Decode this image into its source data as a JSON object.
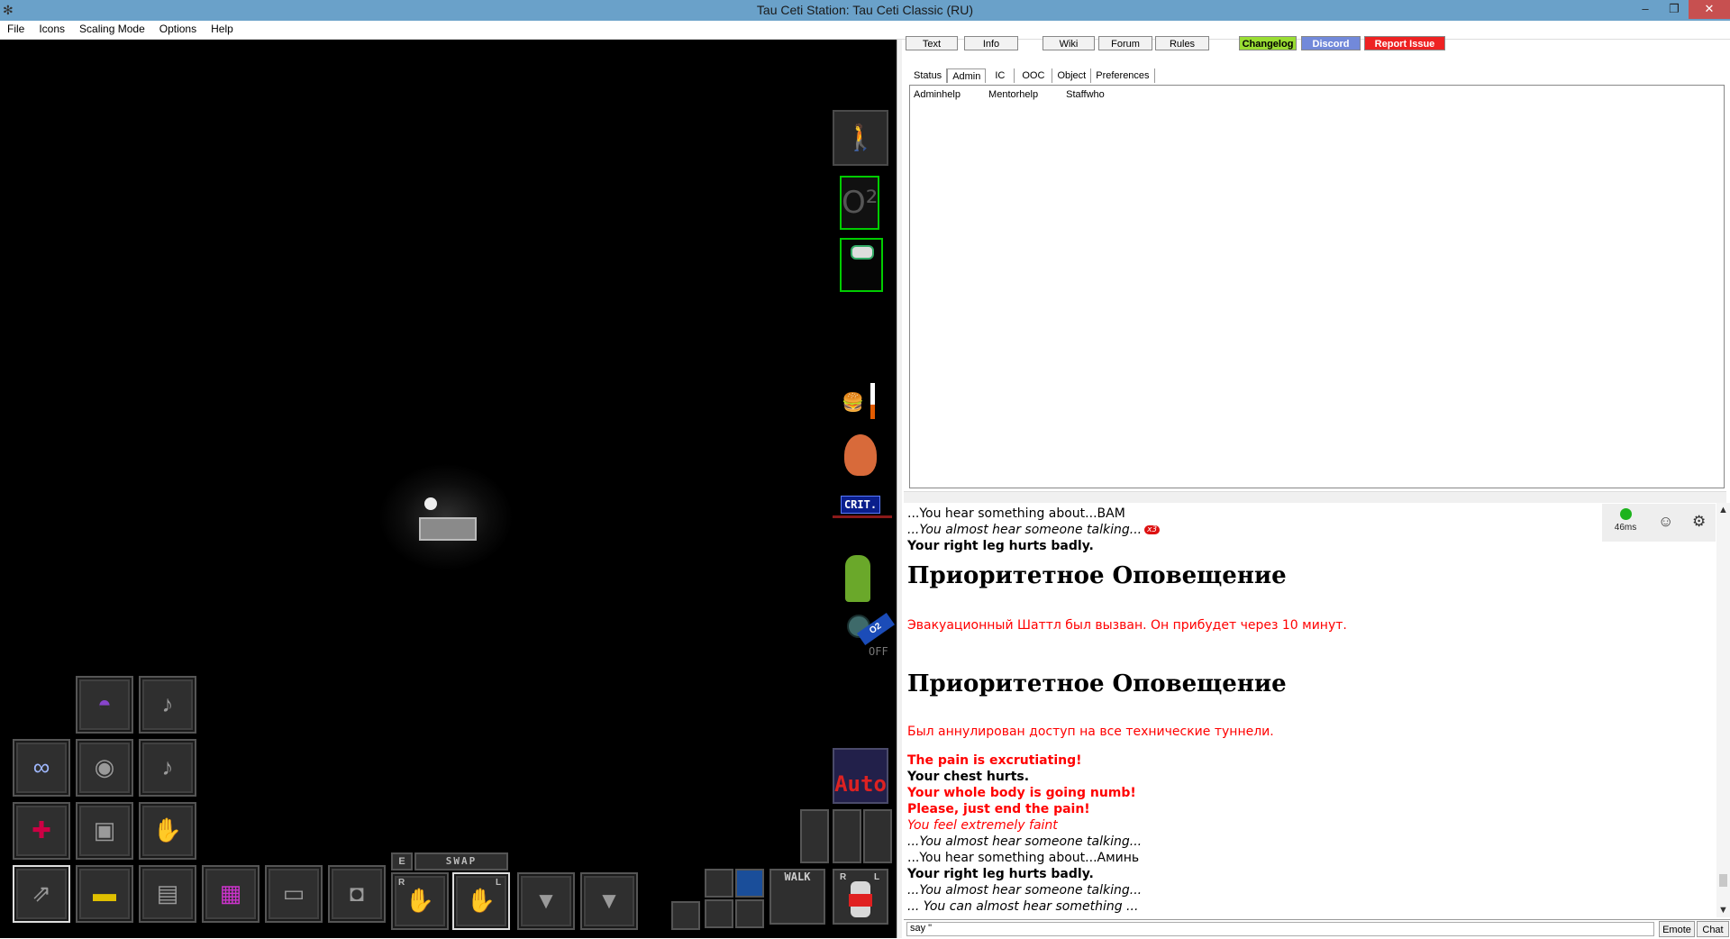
{
  "window": {
    "title": "Tau Ceti Station: Tau Ceti Classic (RU)",
    "minimize": "–",
    "restore": "❐",
    "close": "✕"
  },
  "menu": [
    "File",
    "Icons",
    "Scaling Mode",
    "Options",
    "Help"
  ],
  "top_buttons": {
    "text": "Text",
    "info": "Info",
    "wiki": "Wiki",
    "forum": "Forum",
    "rules": "Rules",
    "changelog": "Changelog",
    "discord": "Discord",
    "report": "Report Issue",
    "changelog_color": "#99dd33",
    "discord_color": "#7289da",
    "report_color": "#ee2222"
  },
  "tabs": [
    "Status",
    "Admin",
    "IC",
    "OOC",
    "Object",
    "Preferences"
  ],
  "admin_links": [
    "Adminhelp",
    "Mentorhelp",
    "Staffwho"
  ],
  "hud": {
    "o2_label": "O²",
    "crit_label": "CRIT.",
    "internals_label": "OFF",
    "internals_tag": "O2",
    "auto_label": "Auto",
    "swap_e": "E",
    "swap_label": "SWAP",
    "hand_right": "R",
    "hand_left": "L",
    "walk_label": "WALK",
    "doll_r": "R",
    "doll_l": "L"
  },
  "chat": {
    "ping": "46ms",
    "badge": "x3",
    "lines": [
      "...You hear something about...BAM",
      "...You almost hear someone talking...",
      "Your right leg hurts badly.",
      "Приоритетное Оповещение",
      "Эвакуационный Шаттл был вызван. Он прибудет через 10 минут.",
      "Приоритетное Оповещение",
      "Был аннулирован доступ на все технические туннели.",
      "The pain is excrutiating!",
      "Your chest hurts.",
      "Your whole body is going numb!",
      "Please, just end the pain!",
      "You feel extremely faint",
      "...You almost hear someone talking...",
      "...You hear something about...Аминь",
      "Your right leg hurts badly.",
      "...You almost hear someone talking...",
      "... You can almost hear something ..."
    ]
  },
  "input": {
    "value": "say \"",
    "emote": "Emote",
    "chat": "Chat"
  }
}
